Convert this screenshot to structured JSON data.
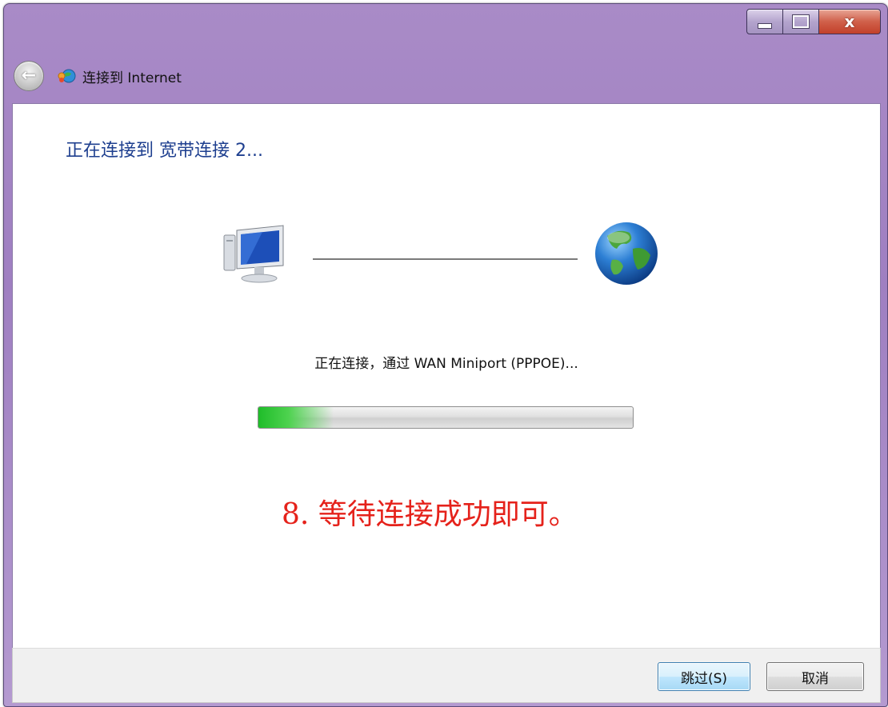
{
  "window": {
    "title": "连接到 Internet",
    "controls": {
      "minimize_icon": "minimize-icon",
      "maximize_icon": "maximize-icon",
      "close_label": "x"
    }
  },
  "nav": {
    "back_icon": "back-arrow-icon",
    "back_glyph": "←",
    "app_icon": "network-icon"
  },
  "main": {
    "heading": "正在连接到 宽带连接 2...",
    "status_text": "正在连接，通过 WAN Miniport (PPPOE)...",
    "progress": 0.2,
    "annotation": "8. 等待连接成功即可。",
    "annotation_color": "#e5221b",
    "heading_color": "#1e3f8f",
    "icons": [
      "computer-icon",
      "globe-icon"
    ]
  },
  "footer": {
    "skip_label": "跳过(S)",
    "cancel_label": "取消"
  }
}
